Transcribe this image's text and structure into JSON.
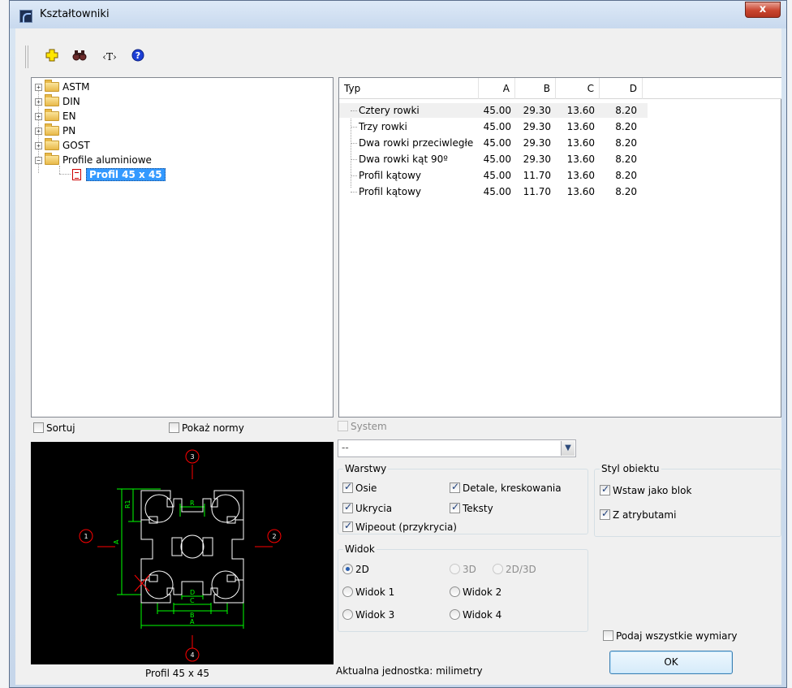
{
  "window": {
    "title": "Kształtowniki",
    "close_glyph": "x"
  },
  "toolbar": {
    "add_icon": "plus-icon",
    "find_icon": "binoculars-icon",
    "text_label": "‹T›",
    "help_glyph": "?"
  },
  "tree": {
    "items": [
      {
        "label": "ASTM",
        "expander": "+"
      },
      {
        "label": "DIN",
        "expander": "+"
      },
      {
        "label": "EN",
        "expander": "+"
      },
      {
        "label": "PN",
        "expander": "+"
      },
      {
        "label": "GOST",
        "expander": "+"
      },
      {
        "label": "Profile aluminiowe",
        "expander": "−"
      }
    ],
    "selected_child": "Profil 45 x 45"
  },
  "table": {
    "headers": [
      "Typ",
      "A",
      "B",
      "C",
      "D"
    ],
    "rows": [
      [
        "Cztery rowki",
        "45.00",
        "29.30",
        "13.60",
        "8.20"
      ],
      [
        "Trzy rowki",
        "45.00",
        "29.30",
        "13.60",
        "8.20"
      ],
      [
        "Dwa rowki przeciwległe",
        "45.00",
        "29.30",
        "13.60",
        "8.20"
      ],
      [
        "Dwa rowki kąt 90º",
        "45.00",
        "29.30",
        "13.60",
        "8.20"
      ],
      [
        "Profil kątowy",
        "45.00",
        "11.70",
        "13.60",
        "8.20"
      ],
      [
        "Profil kątowy",
        "45.00",
        "11.70",
        "13.60",
        "8.20"
      ]
    ]
  },
  "options": {
    "sortuj": "Sortuj",
    "pokaz_normy": "Pokaż normy",
    "system": "System"
  },
  "combo": {
    "value": "--"
  },
  "preview": {
    "caption": "Profil 45 x 45",
    "markers": [
      "1",
      "2",
      "3",
      "4"
    ],
    "dimension_labels": [
      "A",
      "B",
      "C",
      "D",
      "R",
      "R1"
    ]
  },
  "warstwy": {
    "title": "Warstwy",
    "osie": "Osie",
    "detale": "Detale, kreskowania",
    "ukrycia": "Ukrycia",
    "teksty": "Teksty",
    "wipeout": "Wipeout (przykrycia)"
  },
  "widok": {
    "title": "Widok",
    "v2d": "2D",
    "v3d": "3D",
    "v2d3d": "2D/3D",
    "widok1": "Widok 1",
    "widok2": "Widok 2",
    "widok3": "Widok 3",
    "widok4": "Widok 4"
  },
  "styl": {
    "title": "Styl obiektu",
    "wstaw_blok": "Wstaw jako blok",
    "atrybuty": "Z atrybutami"
  },
  "footer": {
    "podaj": "Podaj wszystkie wymiary",
    "unit": "Aktualna jednostka: milimetry",
    "ok": "OK"
  },
  "colors": {
    "drawing_green": "#00ff00",
    "marker_red": "#ff0000",
    "selection_blue": "#3399ff"
  }
}
